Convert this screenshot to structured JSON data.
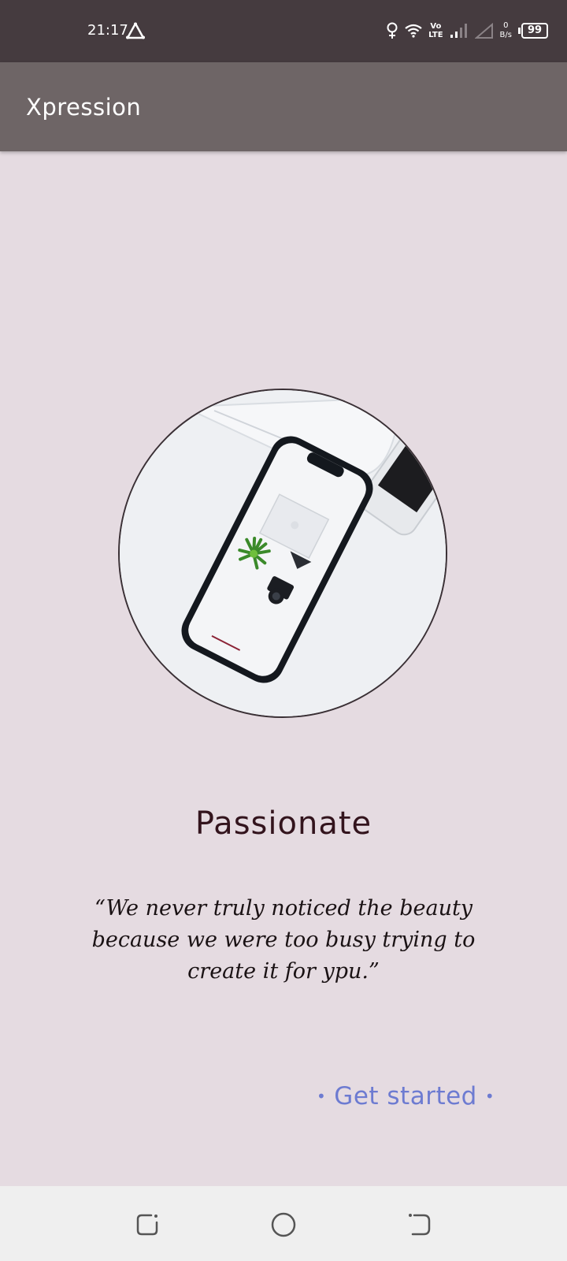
{
  "status_bar": {
    "time": "21:17",
    "vo_label": "Vo",
    "lte_label": "LTE",
    "net_speed_value": "0",
    "net_speed_unit": "B/s",
    "battery": "99"
  },
  "app_bar": {
    "title": "Xpression"
  },
  "hero": {
    "headline": "Passionate",
    "quote": "“We never truly noticed the beauty because we were too busy trying to create it for ypu.”"
  },
  "actions": {
    "get_started": "Get started"
  },
  "colors": {
    "background": "#e5dbe1",
    "status_bar": "#453b3f",
    "app_bar": "#6e6566",
    "headline": "#33141d",
    "accent": "#6d7bd1",
    "nav_bar": "#efefef"
  },
  "icons": {
    "status_left": "navigation-delta-icon",
    "status_right": [
      "location-pin-icon",
      "wifi-icon",
      "cellular-signal-icon",
      "no-signal-icon",
      "battery-icon"
    ],
    "nav": [
      "recent-apps-icon",
      "home-icon",
      "back-icon"
    ]
  }
}
